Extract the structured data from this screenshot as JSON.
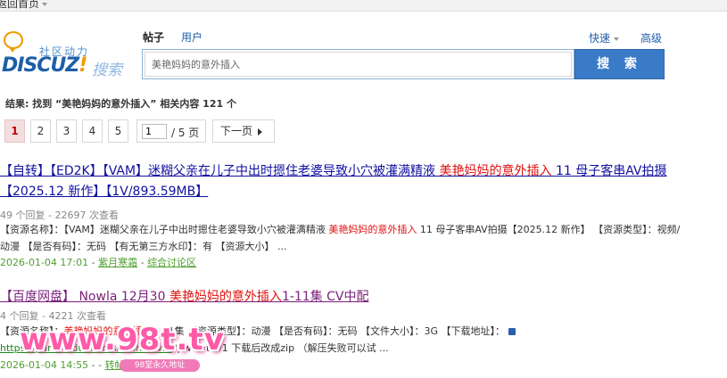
{
  "topbar": {
    "back_label": "返回首页"
  },
  "logo": {
    "community": "社区动力",
    "brand": "DISCUZ",
    "brand_bang": "!",
    "search_word": "搜索"
  },
  "tabs": [
    {
      "label": "帖子"
    },
    {
      "label": "用户"
    }
  ],
  "header_links": {
    "quick": "快速",
    "advanced": "高级"
  },
  "search": {
    "value": "美艳妈妈的意外插入",
    "button": "搜 索"
  },
  "summary": "结果: 找到 “美艳妈妈的意外插入” 相关内容 121 个",
  "pager": {
    "pages": [
      "1",
      "2",
      "3",
      "4",
      "5"
    ],
    "current": "1",
    "jump_value": "1",
    "total": "/ 5 页",
    "next": "下一页"
  },
  "results": [
    {
      "title_pre": "【自转】【ED2K】【VAM】迷糊父亲在儿子中出时摁住老婆导致小穴被灌满精液 ",
      "title_hl": "美艳妈妈的意外插入",
      "title_post": " 11 母子客串AV拍摄【2025.12 新作】【1V/893.59MB】",
      "stats": "49 个回复 - 22697 次查看",
      "desc_pre": "【资源名称】：【VAM】迷糊父亲在儿子中出时摁住老婆导致小穴被灌满精液 ",
      "desc_hl": "美艳妈妈的意外插入",
      "desc_post": " 11 母子客串AV拍摄【2025.12 新作】 【资源类型】：视频/动漫 【是否有码】：无码 【有无第三方水印】：有 【资源大小】 ...",
      "date": "2026-01-04 17:01",
      "sep": " - ",
      "author": "紫月寒霜",
      "sep2": " - ",
      "forum": "综合讨论区"
    },
    {
      "title_pre": "【百度网盘】 Nowla 12月30 ",
      "title_hl": "美艳妈妈的意外插入",
      "title_post": "1-11集 CV中配",
      "stats": "4 个回复 - 4221 次查看",
      "desc_pre": "【资源名称】：",
      "desc_hl": "美艳妈妈的意外插入",
      "desc_post": "1-11集 【资源类型】：动漫 【是否有码】：无码 【文件大小】：3G 【下载地址】：",
      "desc_link": "https://pan.baidu.com/s/1mhM4vIA",
      "desc_tail": "?pwd=t7v1 下载后改成zip （解压失败可以试 ...",
      "date": "2026-01-04 14:55",
      "sep": " - ",
      "author": "",
      "sep2": " - ",
      "forum": "转帖交流区"
    }
  ],
  "watermark": {
    "text": "www.98t.tv",
    "sub": "98堂永久地址"
  },
  "colors": {
    "link": "#1010a0",
    "highlight": "#e01010",
    "meta_green": "#50a030",
    "search_button": "#3a7bc8",
    "pager_current_bg": "#f2dede"
  },
  "icons": {
    "lock": "lock-icon",
    "logo_bubble": "speech-bubble-icon",
    "next_arrow": "arrow-right-icon"
  }
}
